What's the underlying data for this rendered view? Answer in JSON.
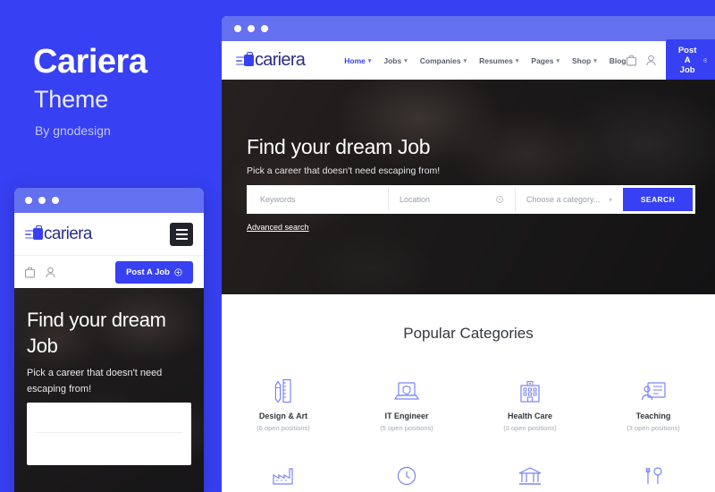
{
  "promo": {
    "title": "Cariera",
    "subtitle": "Theme",
    "author": "By gnodesign"
  },
  "colors": {
    "background": "#3740f2",
    "titlebar": "#6370f0",
    "accent": "#3740f2",
    "logo_text": "#2b2f86"
  },
  "mobile": {
    "logo": "cariera",
    "menu_icon": "hamburger-icon",
    "icons": [
      "briefcase-icon",
      "user-icon"
    ],
    "post_job_label": "Post A Job",
    "hero": {
      "title": "Find your dream Job",
      "subtitle": "Pick a career that doesn't need escaping from!"
    }
  },
  "desktop": {
    "logo": "cariera",
    "nav": [
      {
        "label": "Home",
        "active": true,
        "has_dropdown": true
      },
      {
        "label": "Jobs",
        "active": false,
        "has_dropdown": true
      },
      {
        "label": "Companies",
        "active": false,
        "has_dropdown": true
      },
      {
        "label": "Resumes",
        "active": false,
        "has_dropdown": true
      },
      {
        "label": "Pages",
        "active": false,
        "has_dropdown": true
      },
      {
        "label": "Shop",
        "active": false,
        "has_dropdown": true
      },
      {
        "label": "Blog",
        "active": false,
        "has_dropdown": false
      }
    ],
    "icons": [
      "briefcase-icon",
      "user-icon"
    ],
    "post_job_label": "Post A Job",
    "hero": {
      "title": "Find your dream Job",
      "subtitle": "Pick a career that doesn't need escaping from!",
      "search": {
        "keywords_placeholder": "Keywords",
        "location_placeholder": "Location",
        "category_placeholder": "Choose a category...",
        "button_label": "SEARCH"
      },
      "advanced_search": "Advanced search"
    },
    "categories": {
      "heading": "Popular Categories",
      "row1": [
        {
          "name": "Design & Art",
          "count": "(6 open positions)",
          "icon": "pen-ruler-icon"
        },
        {
          "name": "IT Engineer",
          "count": "(5 open positions)",
          "icon": "laptop-shield-icon"
        },
        {
          "name": "Health Care",
          "count": "(3 open positions)",
          "icon": "hospital-icon"
        },
        {
          "name": "Teaching",
          "count": "(3 open positions)",
          "icon": "teacher-board-icon"
        }
      ],
      "row2": [
        {
          "icon": "factory-icon"
        },
        {
          "icon": "clock-support-icon"
        },
        {
          "icon": "bank-icon"
        },
        {
          "icon": "tools-icon"
        }
      ]
    }
  }
}
